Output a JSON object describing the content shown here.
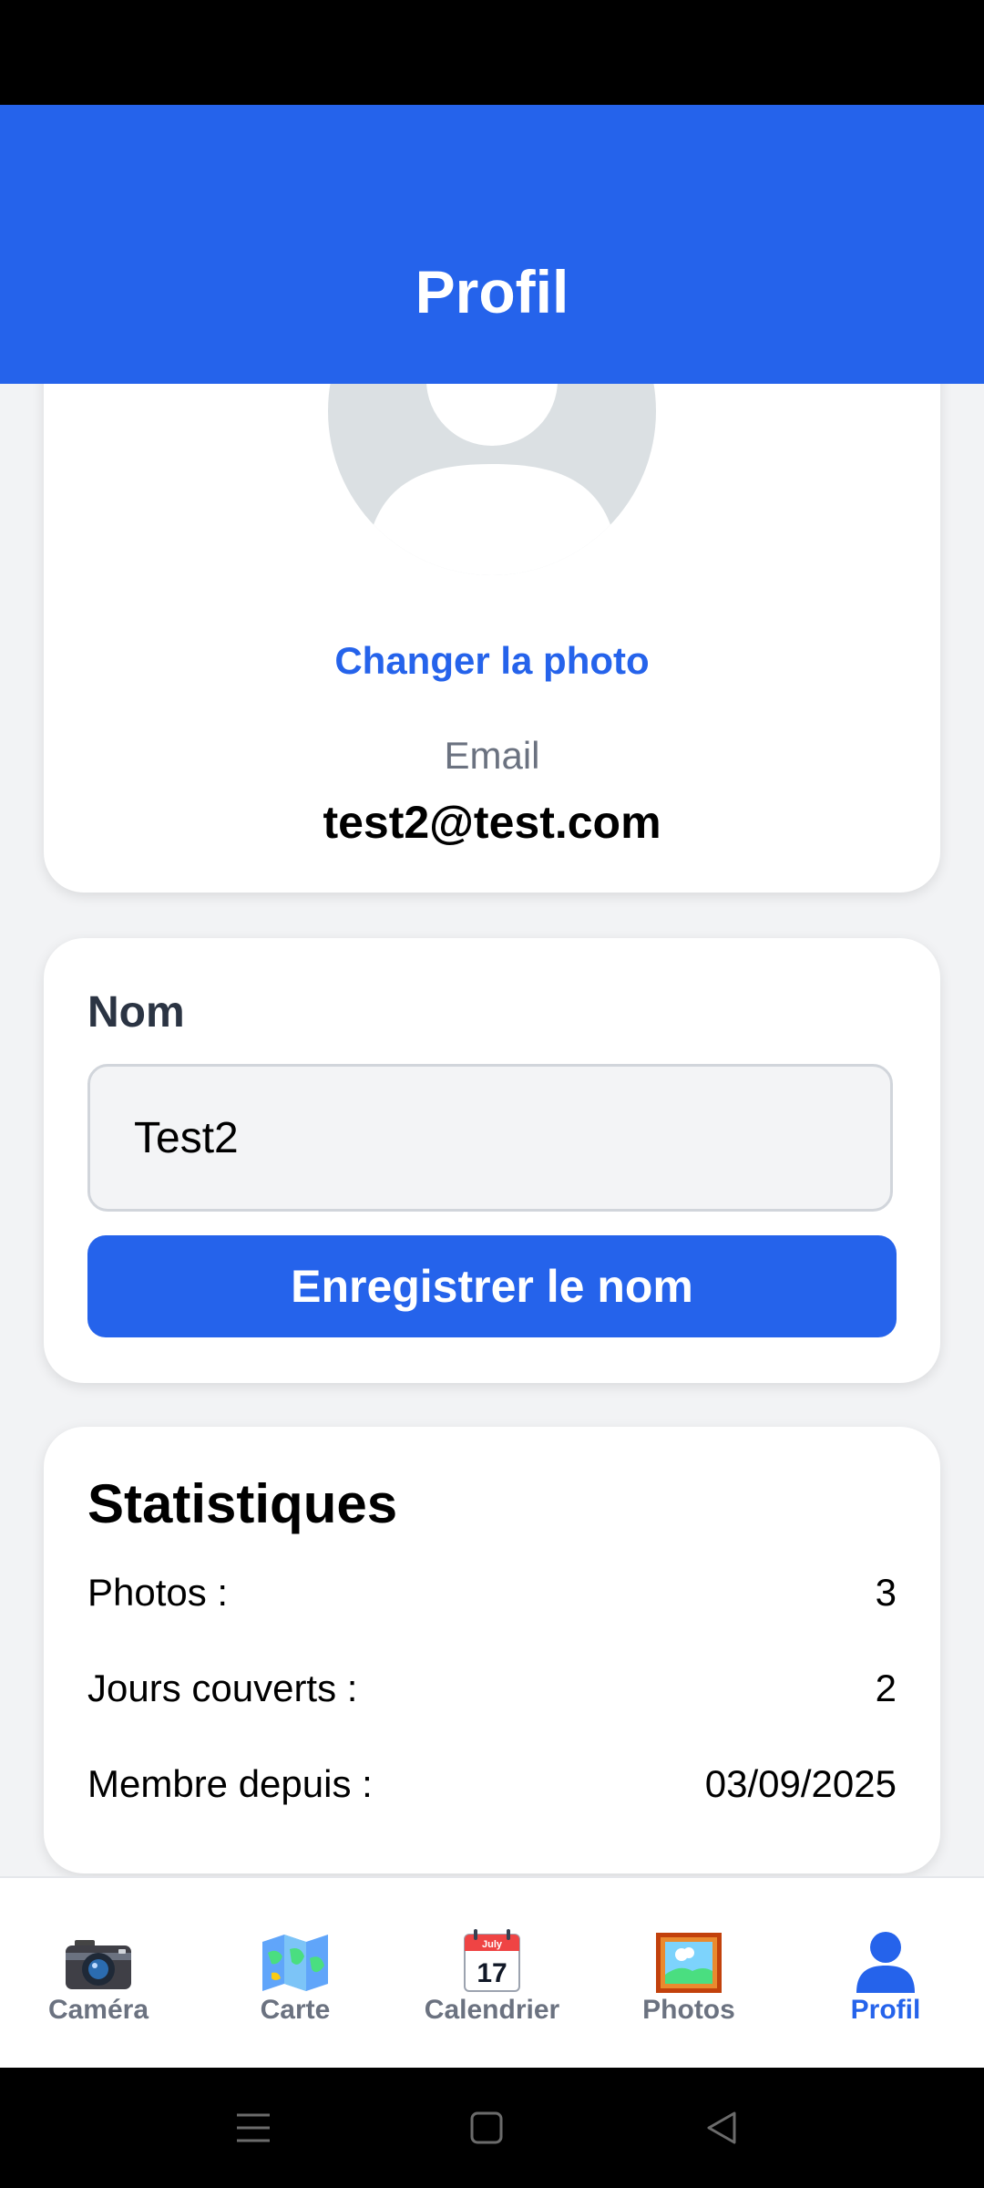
{
  "header": {
    "title": "Profil"
  },
  "profile": {
    "change_photo_label": "Changer la photo",
    "email_label": "Email",
    "email_value": "test2@test.com"
  },
  "name_card": {
    "label": "Nom",
    "input_value": "Test2",
    "save_label": "Enregistrer le nom"
  },
  "stats": {
    "title": "Statistiques",
    "rows": [
      {
        "label": "Photos :",
        "value": "3"
      },
      {
        "label": "Jours couverts :",
        "value": "2"
      },
      {
        "label": "Membre depuis :",
        "value": "03/09/2025"
      }
    ]
  },
  "nav": {
    "items": [
      {
        "label": "Caméra",
        "icon": "camera-icon",
        "active": false
      },
      {
        "label": "Carte",
        "icon": "map-icon",
        "active": false
      },
      {
        "label": "Calendrier",
        "icon": "calendar-icon",
        "active": false
      },
      {
        "label": "Photos",
        "icon": "framed-picture-icon",
        "active": false
      },
      {
        "label": "Profil",
        "icon": "person-icon",
        "active": true
      }
    ],
    "calendar_icon_month": "July",
    "calendar_icon_day": "17"
  },
  "colors": {
    "primary": "#2563eb",
    "background": "#f2f3f5",
    "muted_text": "#6b7280",
    "avatar_placeholder": "#dbe0e3"
  }
}
